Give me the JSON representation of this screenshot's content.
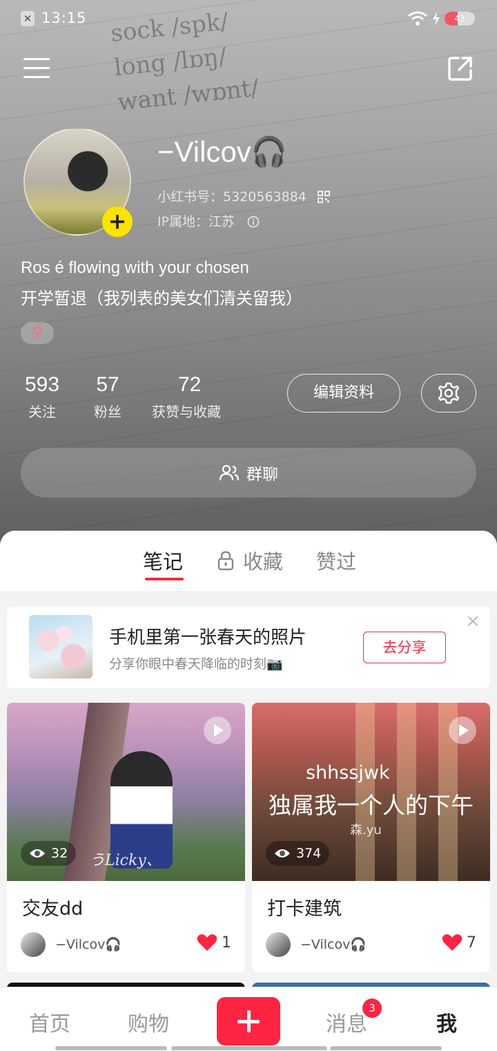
{
  "status_bar": {
    "time": "13:15",
    "battery": "43"
  },
  "profile": {
    "nickname": "−Vilcov🎧",
    "red_id": "小红书号：5320563884",
    "ip": "IP属地：江苏",
    "bio_line1": "Ros é  flowing with your chosen",
    "bio_line2": "开学暂退（我列表的美女们清关留我）",
    "gender": "♀",
    "stats": [
      {
        "value": "593",
        "label": "关注"
      },
      {
        "value": "57",
        "label": "粉丝"
      },
      {
        "value": "72",
        "label": "获赞与收藏"
      }
    ],
    "edit_label": "编辑资料",
    "group_chat_label": "群聊"
  },
  "tabs": [
    {
      "label": "笔记",
      "active": true
    },
    {
      "label": "收藏",
      "locked": true
    },
    {
      "label": "赞过"
    }
  ],
  "promo": {
    "title": "手机里第一张春天的照片",
    "subtitle": "分享你眼中春天降临的时刻📷",
    "button": "去分享",
    "close": "×"
  },
  "notes": [
    {
      "title": "交友dd",
      "views": "32",
      "author": "−Vilcov🎧",
      "likes": "1",
      "overlay_sig": "うLicky、"
    },
    {
      "title": "打卡建筑",
      "views": "374",
      "author": "−Vilcov🎧",
      "likes": "7",
      "overlay_line1": "shhssjwk",
      "overlay_line2": "独属我一个人的下午",
      "overlay_line3": "森.yu"
    }
  ],
  "bottom_nav": [
    {
      "label": "首页"
    },
    {
      "label": "购物"
    },
    {
      "label": "消息",
      "badge": "3"
    },
    {
      "label": "我",
      "active": true
    }
  ],
  "colors": {
    "accent": "#ff2442",
    "plus_yellow": "#ffe300"
  },
  "background_text": [
    "sock /spk/",
    "long /lɒŋ/",
    "want /wɒnt/"
  ]
}
